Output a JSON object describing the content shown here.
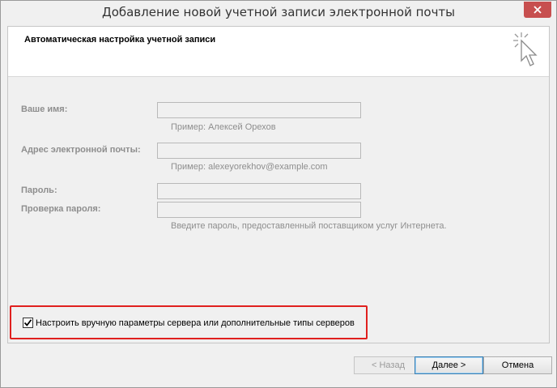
{
  "window": {
    "title": "Добавление новой учетной записи электронной почты",
    "close_label": "close"
  },
  "header": {
    "title": "Автоматическая настройка учетной записи",
    "icon": "wizard-cursor-icon"
  },
  "form": {
    "name": {
      "label": "Ваше имя:",
      "value": "",
      "hint": "Пример: Алексей Орехов"
    },
    "email": {
      "label": "Адрес электронной почты:",
      "value": "",
      "hint": "Пример: alexeyorekhov@example.com"
    },
    "password": {
      "label": "Пароль:",
      "value": ""
    },
    "password_confirm": {
      "label": "Проверка пароля:",
      "value": "",
      "hint": "Введите пароль, предоставленный поставщиком услуг Интернета."
    }
  },
  "manual_setup": {
    "label": "Настроить вручную параметры сервера или дополнительные типы серверов",
    "checked": true
  },
  "buttons": {
    "back": "< Назад",
    "next": "Далее >",
    "cancel": "Отмена"
  },
  "colors": {
    "highlight": "#e0201e",
    "close_button": "#c74f4f",
    "default_button_border": "#3c7fb1"
  }
}
